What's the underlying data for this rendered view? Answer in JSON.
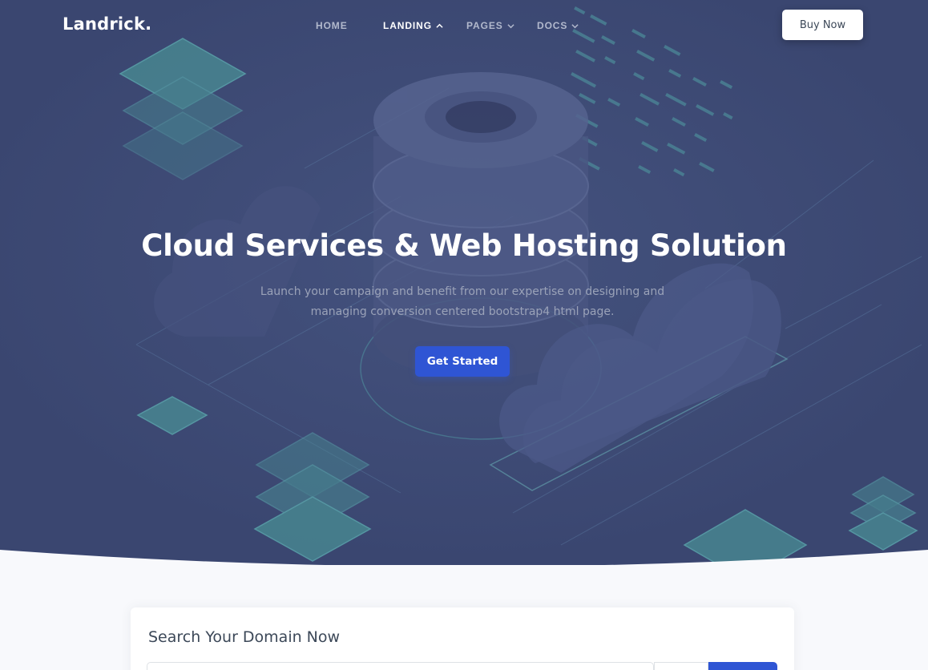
{
  "brand": {
    "logo_text": "Landrick."
  },
  "nav": {
    "items": [
      {
        "label": "HOME",
        "has_dropdown": false,
        "active": false
      },
      {
        "label": "LANDING",
        "has_dropdown": true,
        "active": true
      },
      {
        "label": "PAGES",
        "has_dropdown": true,
        "active": false
      },
      {
        "label": "DOCS",
        "has_dropdown": true,
        "active": false
      }
    ],
    "buy_button": "Buy Now"
  },
  "hero": {
    "title": "Cloud Services & Web Hosting Solution",
    "subtitle_line1": "Launch your campaign and benefit from our expertise on designing and",
    "subtitle_line2": "managing conversion centered bootstrap4 html page.",
    "cta_label": "Get Started",
    "illustration": "isometric-cloud-server-illustration"
  },
  "domain_search": {
    "title": "Search Your Domain Now",
    "input_value": "",
    "input_placeholder": "",
    "tld_selected": "",
    "button_label": ""
  },
  "colors": {
    "hero_bg": "#3a4670",
    "primary": "#2f55d4",
    "page_bg": "#f8f9fc",
    "text_dark": "#3c4858",
    "accent_teal": "#4fa3a8"
  }
}
